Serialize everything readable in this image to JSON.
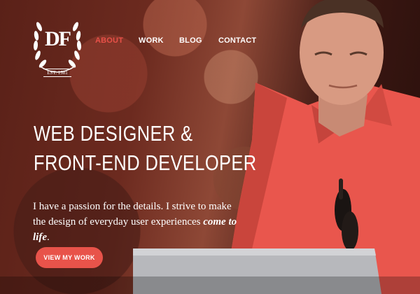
{
  "logo": {
    "monogram": "DF",
    "established": "EST. 1981"
  },
  "nav": {
    "items": [
      {
        "label": "ABOUT",
        "active": true
      },
      {
        "label": "WORK",
        "active": false
      },
      {
        "label": "BLOG",
        "active": false
      },
      {
        "label": "CONTACT",
        "active": false
      }
    ]
  },
  "hero": {
    "headline_line1": "WEB DESIGNER &",
    "headline_line2": "FRONT-END DEVELOPER",
    "tagline_text": "I have a passion for the details. I strive to make the design of everyday user experiences",
    "tagline_emphasis": "come to life",
    "tagline_end": ".",
    "cta_label": "VIEW MY WORK"
  },
  "colors": {
    "accent": "#e8534a",
    "active_nav": "#e85048",
    "text": "#ffffff",
    "background_dark": "#2a100c"
  }
}
